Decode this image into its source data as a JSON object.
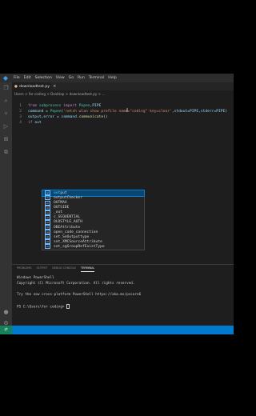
{
  "menu": {
    "items": [
      "File",
      "Edit",
      "Selection",
      "View",
      "Go",
      "Run",
      "Terminal",
      "Help"
    ]
  },
  "activity_bar": {
    "icons": [
      "explorer-icon",
      "search-icon",
      "source-control-icon",
      "run-debug-icon",
      "extensions-icon",
      "remote-icon",
      "accounts-icon",
      "settings-gear-icon"
    ]
  },
  "tab": {
    "filename": "downloadtest.py",
    "icon": "python-icon"
  },
  "breadcrumb": {
    "text": "Users > for coding > Desktop > downloadtest.py > ..."
  },
  "editor": {
    "line_numbers": [
      "1",
      "2",
      "3",
      "4"
    ],
    "lines": [
      [
        {
          "t": "from ",
          "c": "kw"
        },
        {
          "t": "subprocess ",
          "c": "cls"
        },
        {
          "t": "import ",
          "c": "kw"
        },
        {
          "t": "Popen",
          "c": "cls"
        },
        {
          "t": ",",
          "c": "op"
        },
        {
          "t": "PIPE",
          "c": "var"
        }
      ],
      [
        {
          "t": "command ",
          "c": "var"
        },
        {
          "t": "= ",
          "c": "op"
        },
        {
          "t": "Popen",
          "c": "cls"
        },
        {
          "t": "(",
          "c": "op"
        },
        {
          "t": "'netsh wlan show profile name=\"coding\" key=clear'",
          "c": "str"
        },
        {
          "t": ",",
          "c": "op"
        },
        {
          "t": "stdout",
          "c": "var"
        },
        {
          "t": "=",
          "c": "op"
        },
        {
          "t": "PIPE",
          "c": "var"
        },
        {
          "t": ",",
          "c": "op"
        },
        {
          "t": "stderr",
          "c": "var"
        },
        {
          "t": "=",
          "c": "op"
        },
        {
          "t": "PIPE",
          "c": "var"
        },
        {
          "t": ")",
          "c": "op"
        }
      ],
      [
        {
          "t": "output",
          "c": "var"
        },
        {
          "t": ",",
          "c": "op"
        },
        {
          "t": "error ",
          "c": "var"
        },
        {
          "t": "= ",
          "c": "op"
        },
        {
          "t": "command",
          "c": "var"
        },
        {
          "t": ".",
          "c": "op"
        },
        {
          "t": "communicate",
          "c": "fn"
        },
        {
          "t": "()",
          "c": "op"
        }
      ],
      [
        {
          "t": "if ",
          "c": "kw"
        },
        {
          "t": "out",
          "c": "var"
        }
      ]
    ]
  },
  "suggestions": [
    {
      "typed": "out",
      "rest": "put",
      "selected": true
    },
    {
      "typed": "",
      "rest": "outputChecker",
      "selected": false
    },
    {
      "typed": "",
      "rest": "OUTMAX",
      "selected": false
    },
    {
      "typed": "",
      "rest": "OUTSIDE",
      "selected": false
    },
    {
      "typed": "",
      "rest": "_out",
      "selected": false
    },
    {
      "typed": "",
      "rest": "c_SEQUENTIAL",
      "selected": false
    },
    {
      "typed": "",
      "rest": "OLDSTYLE_AUTH",
      "selected": false
    },
    {
      "typed": "",
      "rest": "OBEAttribute",
      "selected": false
    },
    {
      "typed": "",
      "rest": "open_code_connection",
      "selected": false
    },
    {
      "typed": "",
      "rest": "set_SeOutputtype",
      "selected": false
    },
    {
      "typed": "",
      "rest": "set_XMCSourceAttribute",
      "selected": false
    },
    {
      "typed": "",
      "rest": "set_sgGroupRefExistType",
      "selected": false
    }
  ],
  "panel": {
    "tabs": [
      "PROBLEMS",
      "OUTPUT",
      "DEBUG CONSOLE",
      "TERMINAL"
    ],
    "active_tab": "TERMINAL",
    "terminal_lines": [
      "Windows PowerShell",
      "Copyright (C) Microsoft Corporation. All rights reserved.",
      "",
      "Try the new cross-platform PowerShell https://aka.ms/pscore6",
      "",
      "PS C:\\Users\\for coding>"
    ]
  },
  "colors": {
    "statusbar": "#007acc",
    "editor_bg": "#1e1e1e",
    "selection": "#094771"
  }
}
